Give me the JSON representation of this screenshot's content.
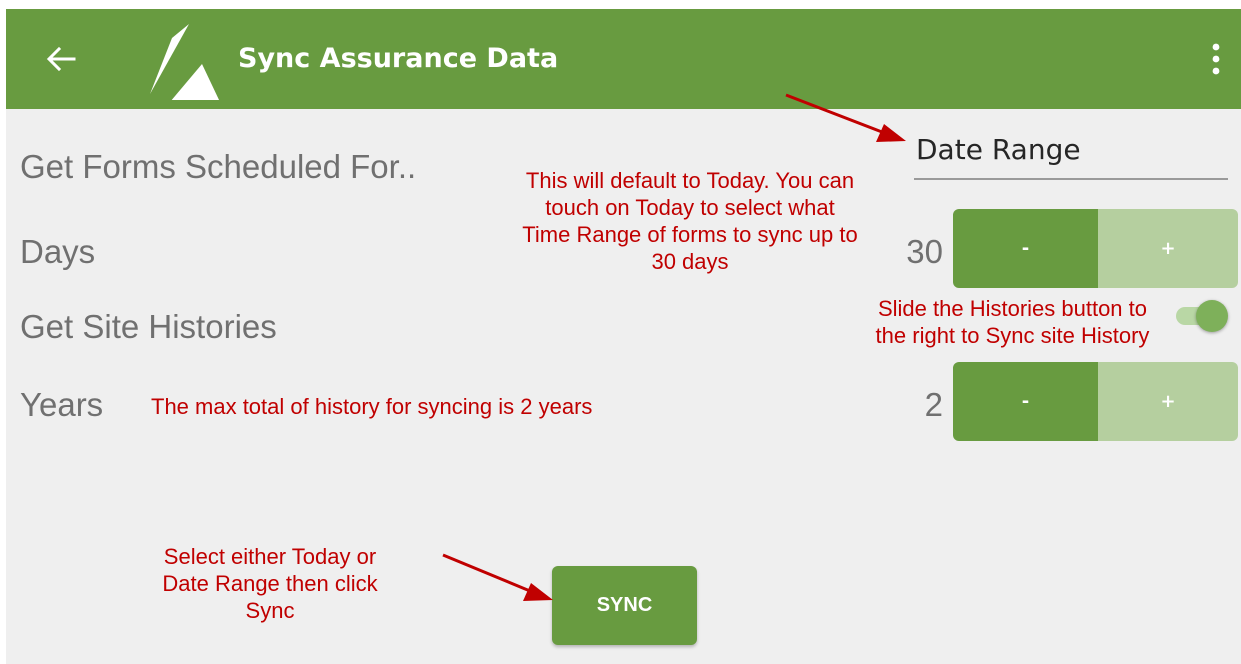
{
  "app_bar": {
    "title": "Sync Assurance Data",
    "back_icon": "arrow-left-icon",
    "logo_icon": "sail-logo-icon",
    "menu_icon": "more-vert-icon",
    "color": "#689b40"
  },
  "form": {
    "scheduled_label": "Get Forms Scheduled For..",
    "date_range_value": "Date Range",
    "days_label": "Days",
    "days_value": "30",
    "site_histories_label": "Get Site Histories",
    "site_histories_enabled": true,
    "years_label": "Years",
    "years_value": "2",
    "minus_label": "-",
    "plus_label": "+",
    "sync_label": "SYNC"
  },
  "annotations": {
    "date_range_note": [
      "This will default to Today. You can",
      "touch on Today to select what",
      "Time Range of forms to sync up to",
      "30 days"
    ],
    "histories_note": [
      "Slide the Histories button to",
      "the right to Sync site History"
    ],
    "years_note": "The max total of history for syncing is 2 years",
    "sync_note": [
      "Select either Today or",
      "Date Range then click",
      "Sync"
    ],
    "color": "#c00000"
  }
}
